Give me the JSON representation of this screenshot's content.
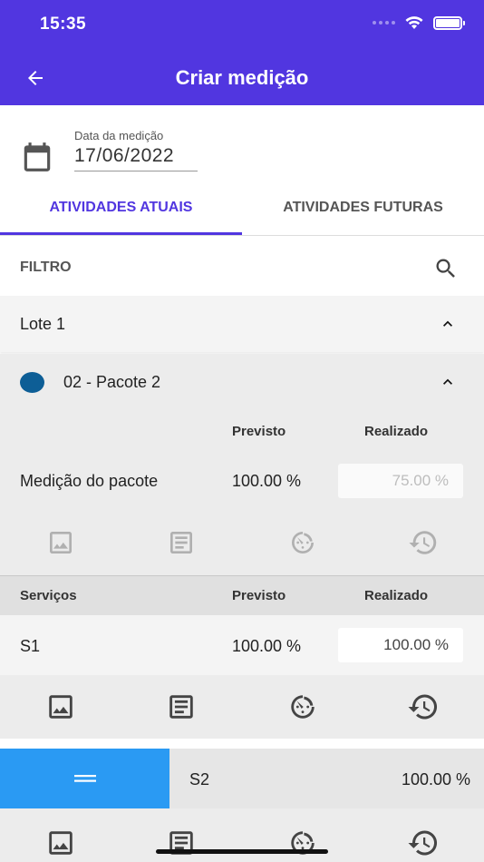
{
  "status_bar": {
    "time": "15:35"
  },
  "header": {
    "title": "Criar medição"
  },
  "date_field": {
    "label": "Data da medição",
    "value": "17/06/2022"
  },
  "tabs": [
    {
      "label": "ATIVIDADES ATUAIS",
      "active": true
    },
    {
      "label": "ATIVIDADES FUTURAS",
      "active": false
    }
  ],
  "filter": {
    "label": "FILTRO"
  },
  "lote": {
    "label": "Lote 1"
  },
  "package": {
    "name": "02 - Pacote 2",
    "dot_color": "#0d5e96",
    "col_previsto": "Previsto",
    "col_realizado": "Realizado",
    "row_label": "Medição do pacote",
    "previsto": "100.00 %",
    "realizado": "75.00 %"
  },
  "services": {
    "header_label": "Serviços",
    "col_previsto": "Previsto",
    "col_realizado": "Realizado",
    "items": [
      {
        "name": "S1",
        "previsto": "100.00 %",
        "realizado": "100.00 %"
      },
      {
        "name": "S2",
        "previsto": "100.00 %"
      }
    ]
  },
  "action_icons": [
    "image-icon",
    "notes-icon",
    "timer-icon",
    "history-icon"
  ],
  "colors": {
    "primary": "#5136e0",
    "drag_handle": "#2a9af3",
    "package_dot": "#0d5e96"
  }
}
